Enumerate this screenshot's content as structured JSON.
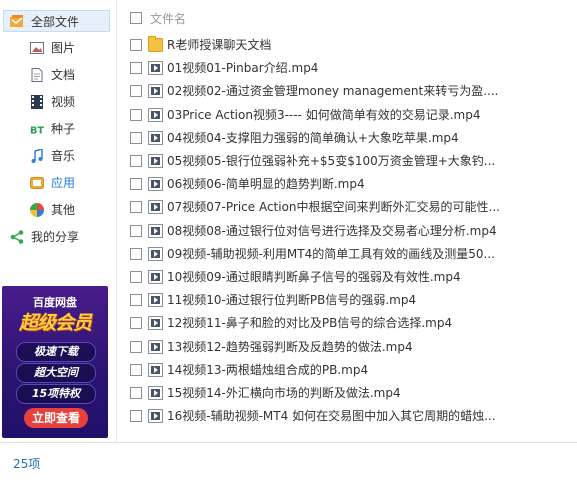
{
  "sidebar": {
    "all_files": "全部文件",
    "items": [
      {
        "label": "图片",
        "icon": "image-icon"
      },
      {
        "label": "文档",
        "icon": "document-icon"
      },
      {
        "label": "视频",
        "icon": "video-icon"
      },
      {
        "label": "种子",
        "icon": "torrent-icon"
      },
      {
        "label": "音乐",
        "icon": "music-icon"
      },
      {
        "label": "应用",
        "icon": "app-icon"
      },
      {
        "label": "其他",
        "icon": "other-icon"
      }
    ],
    "my_share": "我的分享"
  },
  "ad": {
    "brand": "百度网盘",
    "title": "超级会员",
    "perks": [
      "极速下载",
      "超大空间",
      "15项特权"
    ],
    "cta": "立即查看"
  },
  "list": {
    "header": "文件名",
    "rows": [
      {
        "name": "R老师授课聊天文档",
        "type": "folder"
      },
      {
        "name": "01视频01-Pinbar介绍.mp4",
        "type": "video"
      },
      {
        "name": "02视频02-通过资金管理money management来转亏为盈....",
        "type": "video"
      },
      {
        "name": "03Price Action视频3---- 如何做简单有效的交易记录.mp4",
        "type": "video"
      },
      {
        "name": "04视频04-支撑阻力强弱的简单确认+大象吃苹果.mp4",
        "type": "video"
      },
      {
        "name": "05视频05-银行位强弱补充+$5变$100万资金管理+大象钓...",
        "type": "video"
      },
      {
        "name": "06视频06-简单明显的趋势判断.mp4",
        "type": "video"
      },
      {
        "name": "07视频07-Price Action中根据空间来判断外汇交易的可能性...",
        "type": "video"
      },
      {
        "name": "08视频08-通过银行位对信号进行选择及交易者心理分析.mp4",
        "type": "video"
      },
      {
        "name": "09视频-辅助视频-利用MT4的简单工具有效的画线及测量50...",
        "type": "video"
      },
      {
        "name": "10视频09-通过眼睛判断鼻子信号的强弱及有效性.mp4",
        "type": "video"
      },
      {
        "name": "11视频10-通过银行位判断PB信号的强弱.mp4",
        "type": "video"
      },
      {
        "name": "12视频11-鼻子和脸的对比及PB信号的综合选择.mp4",
        "type": "video"
      },
      {
        "name": "13视频12-趋势强弱判断及反趋势的做法.mp4",
        "type": "video"
      },
      {
        "name": "14视频13-两根蜡烛组合成的PB.mp4",
        "type": "video"
      },
      {
        "name": "15视频14-外汇横向市场的判断及做法.mp4",
        "type": "video"
      },
      {
        "name": "16视频-辅助视频-MT4 如何在交易图中加入其它周期的蜡烛...",
        "type": "video"
      }
    ]
  },
  "footer": {
    "count": "25项"
  },
  "colors": {
    "accent": "#1e7fd6",
    "selected_bg": "#e6f0fb",
    "ad_bg": "#2c1572",
    "cta": "#e8413c"
  }
}
